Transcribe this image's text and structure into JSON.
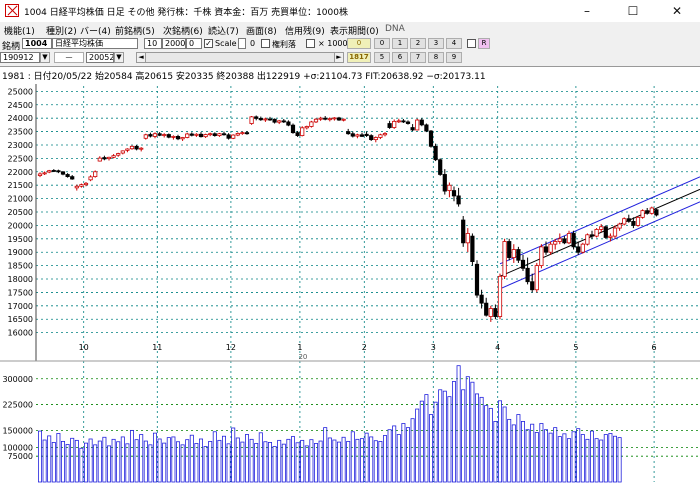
{
  "window": {
    "title": "1004 日経平均株価  日足  その他  発行株：千株  資本金：百万  売買単位：1000株",
    "min_glyph": "–",
    "max_glyph": "☐",
    "close_glyph": "✕"
  },
  "menu": [
    "機能(1)",
    "種別(2)",
    "バー(4)",
    "前銘柄(5)",
    "次銘柄(6)",
    "読込(7)",
    "画面(8)",
    "信用残(9)",
    "表示期間(0)",
    "DNA"
  ],
  "toolbar1": {
    "code_label": "銘柄",
    "code_value": "1004",
    "name_value": "日経平均株価",
    "val1": "10",
    "val2": "2000",
    "val3": "0",
    "scale_label": "Scale",
    "scale_checked": true,
    "scale_value": "0",
    "margin_label": "権利落",
    "mult_label": "× 1000",
    "digit_buttons_top": [
      "0",
      "1",
      "2",
      "3",
      "4"
    ],
    "digit_buttons_bottom": [
      "5",
      "6",
      "7",
      "8",
      "9"
    ],
    "count_top": "0",
    "count_bottom": "1817",
    "r_button": "R"
  },
  "toolbar2": {
    "from_date": "190912",
    "separator": "—",
    "to_date": "200522",
    "left_arrow": "◄",
    "right_arrow": "►"
  },
  "info_line": "1981 : 日付20/05/22  始20584  高20615  安20335  終20388  出122919  +σ:21104.73  FIT:20638.92  −σ:20173.11",
  "colors": {
    "up_candle": "#cc0000",
    "down_candle": "#000000",
    "channel": "#2222dd",
    "fit_line": "#000000",
    "volume_bar": "#2222dd",
    "grid": "#008080",
    "volume_grid": "#008000"
  },
  "chart_data": [
    {
      "type": "candlestick",
      "x_labels": [
        "10",
        "11",
        "12",
        "1",
        "2",
        "3",
        "4",
        "5",
        "6"
      ],
      "year_label": "20",
      "y_ticks": [
        25000,
        24500,
        24000,
        23500,
        23000,
        22500,
        22000,
        21500,
        21000,
        20500,
        20000,
        19500,
        19000,
        18500,
        18000,
        17500,
        17000,
        16500,
        16000
      ],
      "ylim": [
        15800,
        25200
      ],
      "candles": [
        [
          21860,
          21980,
          21800,
          21920
        ],
        [
          21930,
          22010,
          21880,
          21960
        ],
        [
          21990,
          22070,
          21950,
          22040
        ],
        [
          22050,
          22100,
          21990,
          22030
        ],
        [
          22040,
          22080,
          21950,
          22000
        ],
        [
          22000,
          22020,
          21870,
          21910
        ],
        [
          21900,
          21950,
          21780,
          21820
        ],
        [
          21820,
          21880,
          21700,
          21730
        ],
        [
          21400,
          21520,
          21300,
          21460
        ],
        [
          21460,
          21560,
          21410,
          21520
        ],
        [
          21520,
          21620,
          21460,
          21570
        ],
        [
          21700,
          21870,
          21650,
          21810
        ],
        [
          21820,
          22050,
          21780,
          22000
        ],
        [
          22400,
          22580,
          22380,
          22510
        ],
        [
          22530,
          22600,
          22430,
          22480
        ],
        [
          22490,
          22560,
          22420,
          22540
        ],
        [
          22540,
          22660,
          22500,
          22600
        ],
        [
          22620,
          22710,
          22560,
          22680
        ],
        [
          22700,
          22800,
          22650,
          22780
        ],
        [
          22800,
          22880,
          22730,
          22850
        ],
        [
          22860,
          22980,
          22820,
          22950
        ],
        [
          22950,
          23000,
          22800,
          22850
        ],
        [
          22850,
          22920,
          22760,
          22880
        ],
        [
          23250,
          23420,
          23200,
          23380
        ],
        [
          23390,
          23460,
          23280,
          23330
        ],
        [
          23320,
          23470,
          23250,
          23420
        ],
        [
          23420,
          23480,
          23330,
          23360
        ],
        [
          23360,
          23440,
          23280,
          23390
        ],
        [
          23390,
          23430,
          23250,
          23290
        ],
        [
          23300,
          23360,
          23200,
          23320
        ],
        [
          23320,
          23380,
          23180,
          23230
        ],
        [
          23230,
          23300,
          23150,
          23280
        ],
        [
          23280,
          23460,
          23250,
          23410
        ],
        [
          23410,
          23470,
          23320,
          23360
        ],
        [
          23360,
          23440,
          23300,
          23400
        ],
        [
          23400,
          23480,
          23280,
          23310
        ],
        [
          23310,
          23420,
          23260,
          23390
        ],
        [
          23390,
          23460,
          23330,
          23420
        ],
        [
          23420,
          23470,
          23310,
          23350
        ],
        [
          23350,
          23450,
          23300,
          23420
        ],
        [
          23420,
          23500,
          23350,
          23380
        ],
        [
          23380,
          23440,
          23200,
          23250
        ],
        [
          23250,
          23400,
          23220,
          23370
        ],
        [
          23370,
          23470,
          23330,
          23430
        ],
        [
          23430,
          23500,
          23380,
          23460
        ],
        [
          23460,
          23520,
          23380,
          23420
        ],
        [
          23800,
          24080,
          23750,
          24050
        ],
        [
          24050,
          24100,
          23920,
          23990
        ],
        [
          23990,
          24060,
          23900,
          23940
        ],
        [
          23940,
          24020,
          23860,
          23970
        ],
        [
          23970,
          24050,
          23900,
          23960
        ],
        [
          23960,
          23990,
          23800,
          23850
        ],
        [
          23850,
          23930,
          23780,
          23900
        ],
        [
          23900,
          23970,
          23820,
          23860
        ],
        [
          23860,
          23920,
          23700,
          23740
        ],
        [
          23740,
          23800,
          23420,
          23460
        ],
        [
          23460,
          23520,
          23300,
          23350
        ],
        [
          23350,
          23700,
          23320,
          23640
        ],
        [
          23640,
          23720,
          23580,
          23690
        ],
        [
          23690,
          23900,
          23650,
          23860
        ],
        [
          23860,
          24000,
          23820,
          23960
        ],
        [
          23960,
          24050,
          23900,
          24000
        ],
        [
          24000,
          24080,
          23920,
          23960
        ],
        [
          23960,
          24030,
          23880,
          23980
        ],
        [
          23980,
          24040,
          23910,
          24010
        ],
        [
          24010,
          24050,
          23900,
          23930
        ],
        [
          23950,
          23990,
          23880,
          23960
        ],
        [
          23500,
          23600,
          23380,
          23420
        ],
        [
          23420,
          23500,
          23280,
          23330
        ],
        [
          23330,
          23420,
          23250,
          23380
        ],
        [
          23380,
          23460,
          23300,
          23320
        ],
        [
          23400,
          23500,
          23300,
          23350
        ],
        [
          23350,
          23400,
          23150,
          23200
        ],
        [
          23200,
          23320,
          23100,
          23280
        ],
        [
          23280,
          23420,
          23220,
          23380
        ],
        [
          23380,
          23480,
          23320,
          23430
        ],
        [
          23800,
          23900,
          23600,
          23650
        ],
        [
          23650,
          23950,
          23600,
          23880
        ],
        [
          23880,
          23980,
          23820,
          23900
        ],
        [
          23900,
          23970,
          23820,
          23860
        ],
        [
          23860,
          23920,
          23760,
          23800
        ],
        [
          23650,
          23780,
          23520,
          23560
        ],
        [
          23560,
          23980,
          23540,
          23930
        ],
        [
          23930,
          24000,
          23700,
          23750
        ],
        [
          23750,
          23800,
          23480,
          23520
        ],
        [
          23520,
          23560,
          22900,
          22950
        ],
        [
          22950,
          23050,
          22400,
          22450
        ],
        [
          22450,
          22500,
          21850,
          21900
        ],
        [
          21900,
          22100,
          21150,
          21280
        ],
        [
          21300,
          21600,
          21050,
          21500
        ],
        [
          21300,
          21450,
          20900,
          21100
        ],
        [
          21100,
          21400,
          20700,
          20800
        ],
        [
          20200,
          20350,
          19200,
          19350
        ],
        [
          19350,
          19900,
          19000,
          19700
        ],
        [
          19600,
          19700,
          18500,
          18650
        ],
        [
          18550,
          18700,
          17300,
          17400
        ],
        [
          17400,
          17600,
          16900,
          17100
        ],
        [
          17100,
          17300,
          16600,
          16650
        ],
        [
          16600,
          17000,
          16400,
          16900
        ],
        [
          16900,
          17050,
          16500,
          16600
        ],
        [
          16600,
          18200,
          16500,
          18100
        ],
        [
          18100,
          19500,
          18000,
          19400
        ],
        [
          19400,
          19500,
          18700,
          18800
        ],
        [
          18800,
          19300,
          18600,
          19100
        ],
        [
          19100,
          19200,
          18600,
          18700
        ],
        [
          18700,
          18900,
          18300,
          18400
        ],
        [
          18400,
          18800,
          17800,
          17900
        ],
        [
          17900,
          18200,
          17500,
          17600
        ],
        [
          17600,
          18600,
          17500,
          18500
        ],
        [
          18500,
          19300,
          18400,
          19200
        ],
        [
          19200,
          19400,
          18900,
          19000
        ],
        [
          19000,
          19400,
          18900,
          19300
        ],
        [
          19300,
          19500,
          19100,
          19400
        ],
        [
          19400,
          19700,
          19300,
          19500
        ],
        [
          19500,
          19600,
          19300,
          19350
        ],
        [
          19350,
          19800,
          19300,
          19700
        ],
        [
          19700,
          19800,
          19100,
          19200
        ],
        [
          19200,
          19400,
          18900,
          19000
        ],
        [
          19000,
          19350,
          18950,
          19300
        ],
        [
          19300,
          19700,
          19250,
          19650
        ],
        [
          19650,
          19800,
          19500,
          19600
        ],
        [
          19600,
          19900,
          19550,
          19850
        ],
        [
          19850,
          20050,
          19750,
          19950
        ],
        [
          19950,
          20000,
          19500,
          19550
        ],
        [
          19550,
          19700,
          19400,
          19600
        ],
        [
          19600,
          20000,
          19500,
          19900
        ],
        [
          19900,
          20100,
          19800,
          20050
        ],
        [
          20050,
          20300,
          20000,
          20250
        ],
        [
          20250,
          20400,
          20100,
          20150
        ],
        [
          20150,
          20300,
          19900,
          20000
        ],
        [
          20000,
          20350,
          19950,
          20300
        ],
        [
          20300,
          20600,
          20250,
          20550
        ],
        [
          20550,
          20650,
          20400,
          20450
        ],
        [
          20450,
          20700,
          20400,
          20650
        ],
        [
          20584,
          20615,
          20335,
          20388
        ]
      ],
      "regression_channel": {
        "x_start_index": 100,
        "fit_start": 18100,
        "fit_end": 20638.92,
        "sigma_offset": 465.81,
        "extended_until_edge": true
      }
    },
    {
      "type": "bar",
      "series_name": "volume",
      "y_ticks": [
        300000,
        225000,
        150000,
        100000,
        75000
      ],
      "ylim": [
        0,
        340000
      ],
      "values": [
        148000,
        122000,
        134000,
        115000,
        141000,
        118000,
        109000,
        127000,
        121000,
        98000,
        113000,
        125000,
        108000,
        119000,
        130000,
        105000,
        124000,
        117000,
        131000,
        111000,
        150000,
        123000,
        138000,
        119000,
        108000,
        142000,
        125000,
        113000,
        129000,
        131000,
        117000,
        108000,
        123000,
        136000,
        112000,
        125000,
        103000,
        118000,
        146000,
        121000,
        133000,
        111000,
        157000,
        128000,
        116000,
        138000,
        124000,
        112000,
        143000,
        117000,
        115000,
        103000,
        121000,
        110000,
        124000,
        132000,
        114000,
        121000,
        105000,
        123000,
        112000,
        119000,
        158000,
        128000,
        122000,
        116000,
        130000,
        118000,
        146000,
        124000,
        126000,
        142000,
        131000,
        120000,
        118000,
        135000,
        152000,
        163000,
        138000,
        170000,
        158000,
        184000,
        212000,
        235000,
        254000,
        196000,
        232000,
        268000,
        264000,
        248000,
        292000,
        338000,
        268000,
        306000,
        290000,
        256000,
        246000,
        222000,
        214000,
        176000,
        236000,
        218000,
        182000,
        166000,
        196000,
        176000,
        152000,
        168000,
        144000,
        170000,
        152000,
        142000,
        158000,
        132000,
        140000,
        126000,
        146000,
        155000,
        138000,
        124000,
        148000,
        126000,
        122000,
        138000,
        141000,
        133000,
        129000
      ]
    }
  ]
}
